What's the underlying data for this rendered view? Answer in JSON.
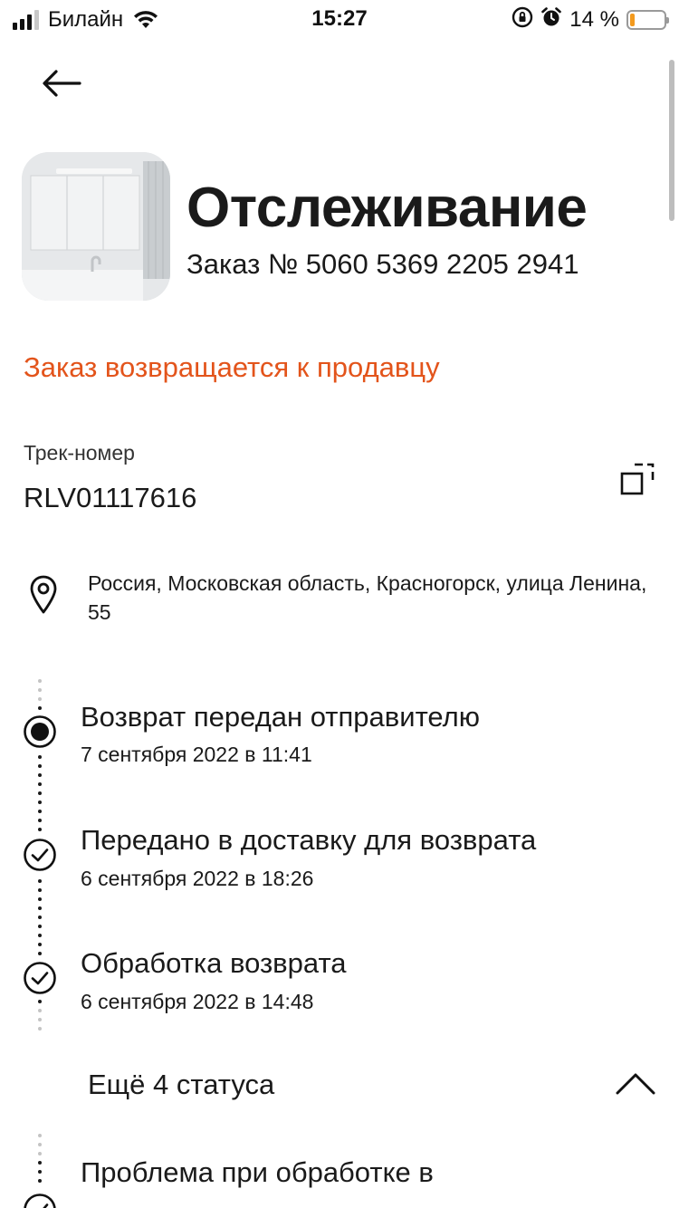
{
  "status_bar": {
    "carrier": "Билайн",
    "time": "15:27",
    "battery_percent": "14 %",
    "battery_level": 0.14,
    "icons": [
      "signal-icon",
      "wifi-icon",
      "orientation-lock-icon",
      "alarm-icon",
      "battery-icon"
    ]
  },
  "header": {
    "back_icon": "arrow-left-icon",
    "title": "Отслеживание",
    "order_number": "Заказ № 5060 5369 2205 2941"
  },
  "order": {
    "status": "Заказ возвращается к продавцу",
    "status_color": "#e3541b"
  },
  "tracking": {
    "label": "Трек-номер",
    "number": "RLV01117616",
    "copy_icon": "copy-icon"
  },
  "delivery": {
    "icon": "location-pin-icon",
    "address": "Россия, Московская область, Красногорск, улица Ленина, 55"
  },
  "timeline": [
    {
      "title": "Возврат передан отправителю",
      "date": "7 сентября 2022 в 11:41",
      "icon": "current-status-icon"
    },
    {
      "title": "Передано в доставку для возврата",
      "date": "6 сентября 2022 в 18:26",
      "icon": "check-circle-icon"
    },
    {
      "title": "Обработка возврата",
      "date": "6 сентября 2022 в 14:48",
      "icon": "check-circle-icon"
    }
  ],
  "more": {
    "label": "Ещё 4 статуса",
    "icon": "chevron-up-icon"
  },
  "timeline_more": [
    {
      "title": "Проблема при обработке в",
      "icon": "check-circle-icon"
    }
  ]
}
